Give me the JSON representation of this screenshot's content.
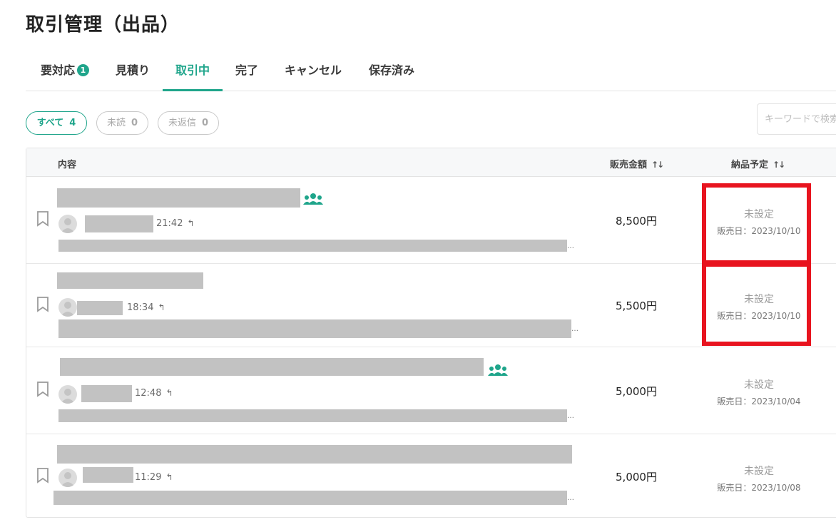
{
  "page": {
    "title": "取引管理（出品）"
  },
  "tabs": [
    {
      "label": "要対応",
      "badge": "1"
    },
    {
      "label": "見積り"
    },
    {
      "label": "取引中"
    },
    {
      "label": "完了"
    },
    {
      "label": "キャンセル"
    },
    {
      "label": "保存済み"
    }
  ],
  "filters": [
    {
      "label": "すべて",
      "count": "4"
    },
    {
      "label": "未読",
      "count": "0"
    },
    {
      "label": "未返信",
      "count": "0"
    }
  ],
  "search": {
    "placeholder": "キーワードで検索"
  },
  "table": {
    "headers": {
      "content": "内容",
      "price": "販売金額",
      "due": "納品予定"
    },
    "rows": [
      {
        "time": "21:42",
        "price": "8,500円",
        "due": "未設定",
        "sale_date": "販売日：2023/10/10"
      },
      {
        "time": "18:34",
        "price": "5,500円",
        "due": "未設定",
        "sale_date": "販売日：2023/10/10"
      },
      {
        "time": "12:48",
        "price": "5,000円",
        "due": "未設定",
        "sale_date": "販売日：2023/10/04"
      },
      {
        "time": "11:29",
        "price": "5,000円",
        "due": "未設定",
        "sale_date": "販売日：2023/10/08"
      }
    ]
  },
  "icons": {
    "bookmark": "bookmark-icon",
    "reply": "reply-icon",
    "group": "group-icon",
    "avatar": "user-avatar-icon",
    "sort": "sort-icon"
  },
  "colors": {
    "accent": "#1fa58b",
    "highlight": "#e8141f",
    "redaction": "#c2c2c2"
  }
}
